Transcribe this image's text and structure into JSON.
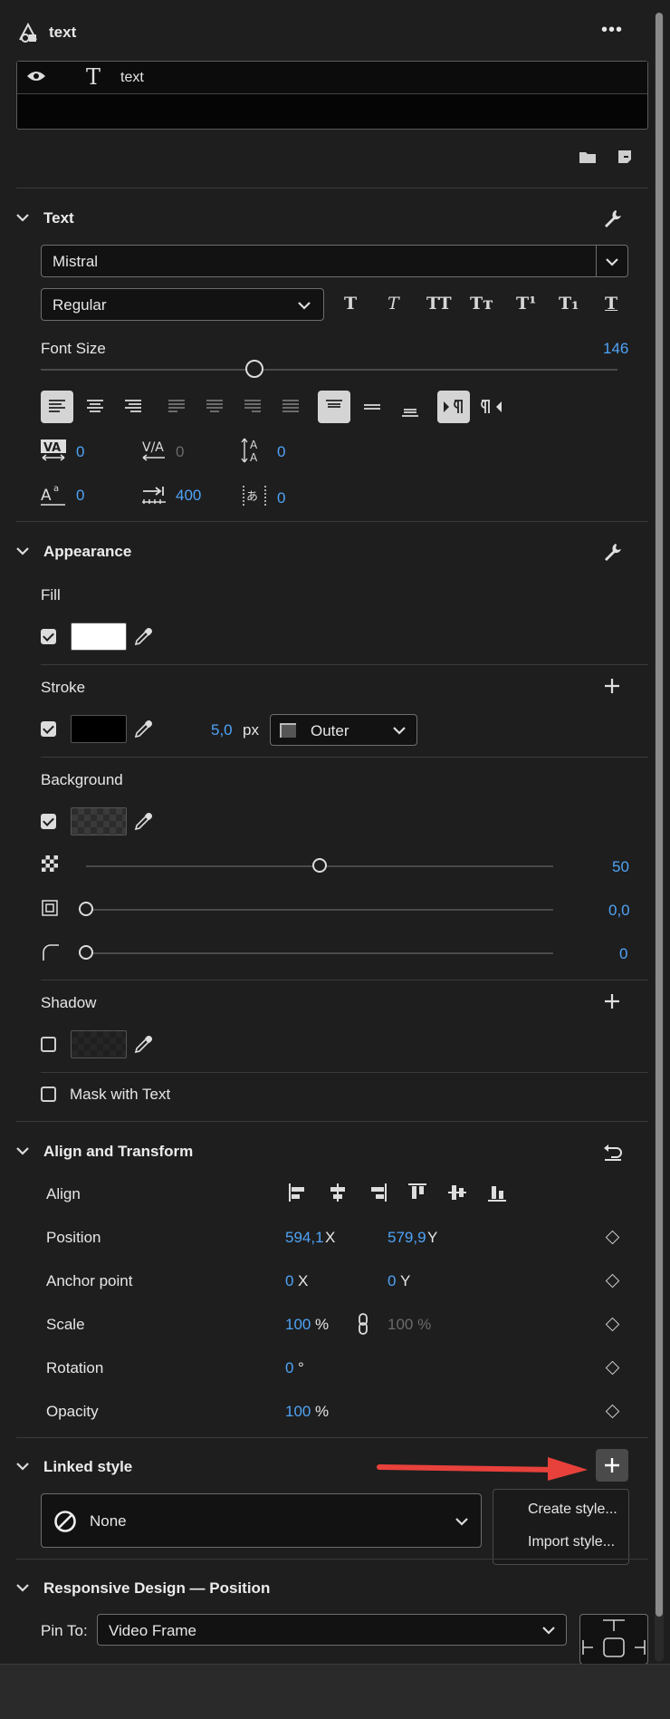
{
  "header": {
    "title": "text",
    "more_label": "•••"
  },
  "layers": {
    "item_label": "text"
  },
  "text_section": {
    "title": "Text",
    "font": "Mistral",
    "style": "Regular",
    "style_buttons": [
      "T",
      "T",
      "TT",
      "Tт",
      "T¹",
      "T₁",
      "T"
    ],
    "font_size_label": "Font Size",
    "font_size_value": "146",
    "font_size_level": 0.37,
    "kerning": "0",
    "tracking": "0",
    "leading": "0",
    "baseline": "0",
    "tab_width": "400",
    "tsume": "0"
  },
  "appearance": {
    "title": "Appearance",
    "fill_label": "Fill",
    "stroke_label": "Stroke",
    "stroke_width": "5,0",
    "stroke_unit": "px",
    "stroke_type": "Outer",
    "background_label": "Background",
    "bg_opacity": "50",
    "bg_opacity_level": 0.5,
    "bg_size": "0,0",
    "bg_size_level": 0,
    "bg_corner": "0",
    "bg_corner_level": 0,
    "shadow_label": "Shadow",
    "mask_label": "Mask with Text"
  },
  "transform": {
    "title": "Align and Transform",
    "align_label": "Align",
    "position_label": "Position",
    "position_x": "594,1",
    "position_y": "579,9",
    "x_unit": "X",
    "y_unit": "Y",
    "anchor_label": "Anchor point",
    "anchor_x": "0",
    "anchor_y": "0",
    "scale_label": "Scale",
    "scale_value": "100",
    "scale_unit": "%",
    "scale_linked": "100 %",
    "rotation_label": "Rotation",
    "rotation_value": "0",
    "rotation_unit": "°",
    "opacity_label": "Opacity",
    "opacity_value": "100",
    "opacity_unit": "%"
  },
  "linked_style": {
    "title": "Linked style",
    "value": "None",
    "menu": [
      "Create style...",
      "Import style..."
    ]
  },
  "responsive": {
    "title": "Responsive Design — Position",
    "pin_label": "Pin To:",
    "pin_value": "Video Frame"
  },
  "colors": {
    "accent": "#4fa3f7",
    "annotation_arrow": "#e8413b",
    "panel_bg": "#1e1e1e"
  }
}
